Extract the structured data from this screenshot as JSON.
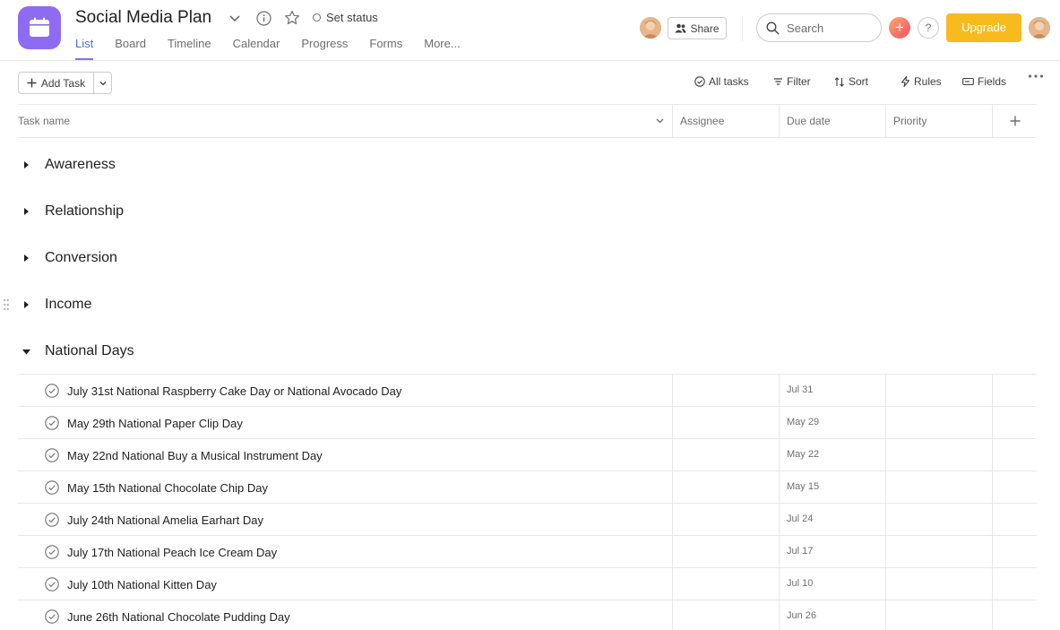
{
  "project": {
    "title": "Social Media Plan",
    "set_status": "Set status",
    "icon_color": "#8d6cf2"
  },
  "tabs": [
    {
      "label": "List",
      "active": true
    },
    {
      "label": "Board"
    },
    {
      "label": "Timeline"
    },
    {
      "label": "Calendar"
    },
    {
      "label": "Progress"
    },
    {
      "label": "Forms"
    },
    {
      "label": "More..."
    }
  ],
  "header_actions": {
    "share_label": "Share",
    "search_placeholder": "Search",
    "help_label": "?",
    "upgrade_label": "Upgrade",
    "upgrade_color": "#f8bb1e"
  },
  "toolbar": {
    "add_task_label": "Add Task",
    "all_tasks_label": "All tasks",
    "filter_label": "Filter",
    "sort_label": "Sort",
    "rules_label": "Rules",
    "fields_label": "Fields"
  },
  "columns": {
    "task_name": "Task name",
    "assignee": "Assignee",
    "due_date": "Due date",
    "priority": "Priority"
  },
  "sections": [
    {
      "title": "Awareness",
      "expanded": false
    },
    {
      "title": "Relationship",
      "expanded": false
    },
    {
      "title": "Conversion",
      "expanded": false
    },
    {
      "title": "Income",
      "expanded": false
    },
    {
      "title": "National Days",
      "expanded": true
    }
  ],
  "tasks": [
    {
      "name": "July 31st National Raspberry Cake Day or National Avocado Day",
      "due": "Jul 31"
    },
    {
      "name": "May 29th National Paper Clip Day",
      "due": "May 29"
    },
    {
      "name": "May 22nd National Buy a Musical Instrument Day",
      "due": "May 22"
    },
    {
      "name": "May 15th National Chocolate Chip Day",
      "due": "May 15"
    },
    {
      "name": "July 24th National Amelia Earhart Day",
      "due": "Jul 24"
    },
    {
      "name": "July 17th National Peach Ice Cream Day",
      "due": "Jul 17"
    },
    {
      "name": "July 10th National Kitten Day",
      "due": "Jul 10"
    },
    {
      "name": "June 26th National Chocolate Pudding Day",
      "due": "Jun 26"
    }
  ]
}
